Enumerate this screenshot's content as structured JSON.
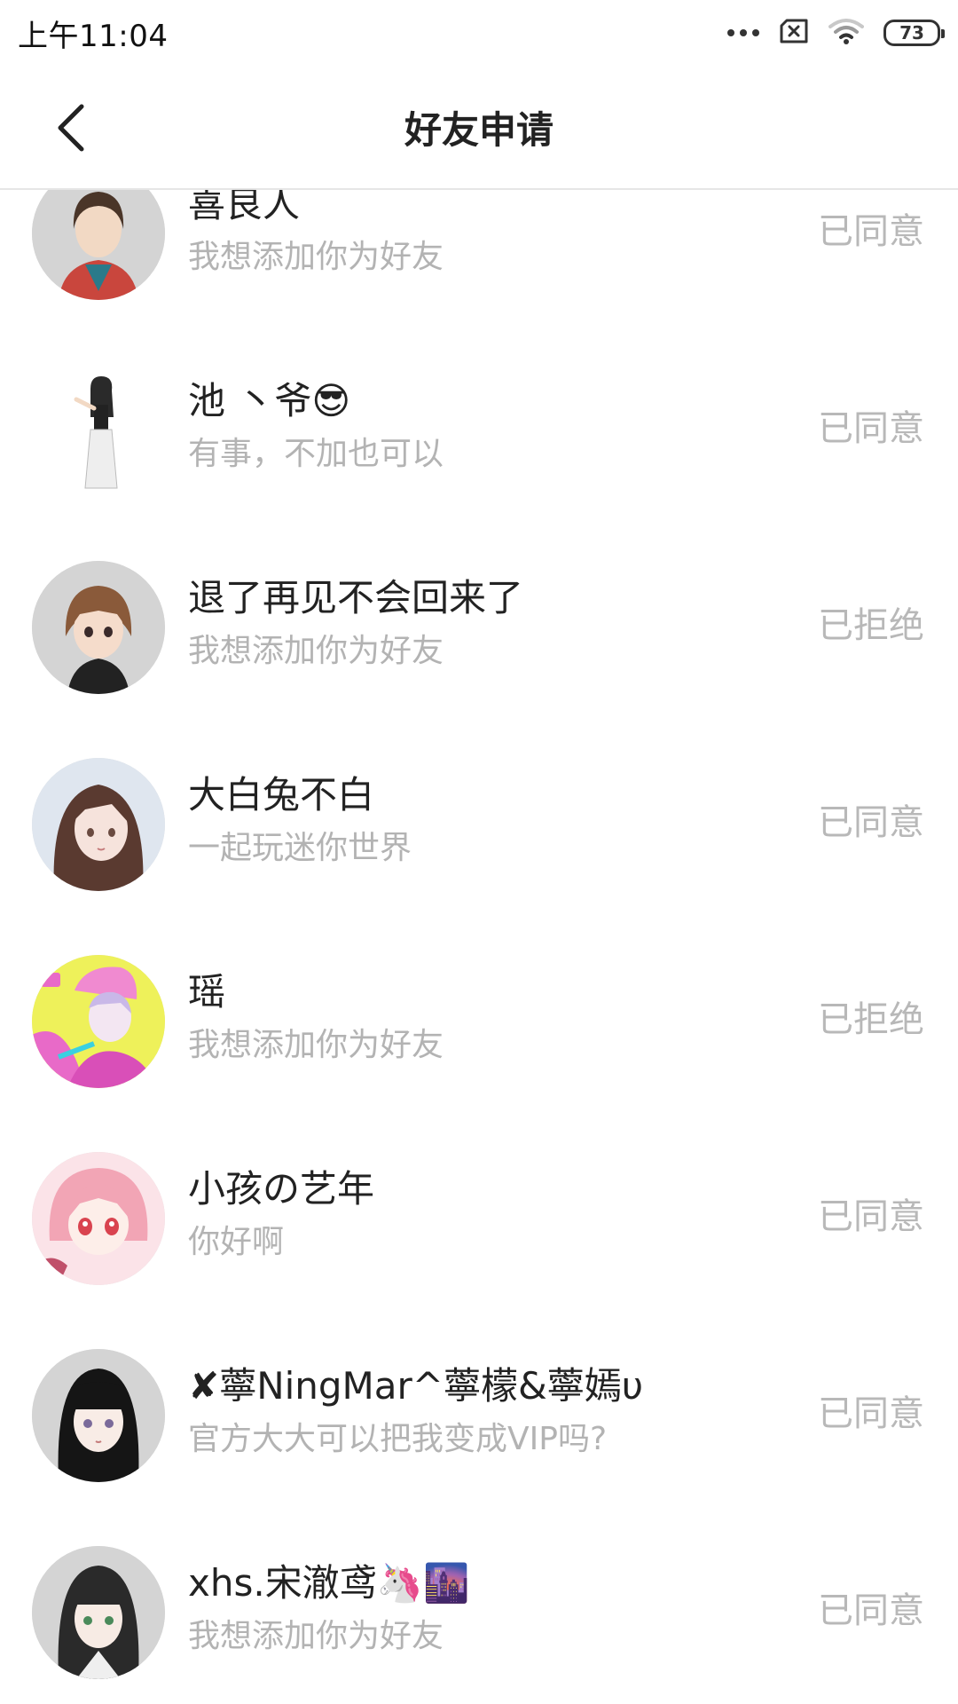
{
  "status_bar": {
    "time": "上午11:04",
    "battery": "73",
    "icons": [
      "more-dots-icon",
      "sim-none-icon",
      "wifi-icon",
      "battery-icon"
    ]
  },
  "header": {
    "title": "好友申请",
    "back_icon": "chevron-left-icon"
  },
  "requests": [
    {
      "name": "喜良人",
      "message": "我想添加你为好友",
      "status": "已同意",
      "avatar_color": "#c9463d"
    },
    {
      "name": "池 丶爷😎",
      "message": "有事，不加也可以",
      "status": "已同意",
      "avatar_color": "#ffffff"
    },
    {
      "name": "退了再见不会回来了",
      "message": "我想添加你为好友",
      "status": "已拒绝",
      "avatar_color": "#8a5a3a"
    },
    {
      "name": "大白兔不白",
      "message": "一起玩迷你世界",
      "status": "已同意",
      "avatar_color": "#d9c8c2"
    },
    {
      "name": "瑶",
      "message": "我想添加你为好友",
      "status": "已拒绝",
      "avatar_color": "#e86ac8"
    },
    {
      "name": "小孩の艺年",
      "message": "你好啊",
      "status": "已同意",
      "avatar_color": "#f2a5b5"
    },
    {
      "name": "✘薴NingMar^薴檬&薴嫣υ",
      "message": "官方大大可以把我变成VIP吗?",
      "status": "已同意",
      "avatar_color": "#1a1a1a"
    },
    {
      "name": "xhs.宋澈鸢🦄🌆",
      "message": "我想添加你为好友",
      "status": "已同意",
      "avatar_color": "#2a2a2a"
    }
  ],
  "colors": {
    "accent_text": "#222222",
    "secondary_text": "#b3b3b3",
    "status_text": "#b8b8b8",
    "divider": "#e6e6e6"
  }
}
